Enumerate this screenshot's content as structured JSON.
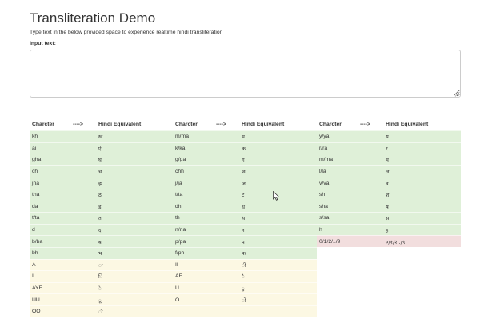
{
  "title": "Transliteration Demo",
  "description": "Type text in the below provided space to experience realtime hindi transliteration",
  "input_label": "Input text:",
  "input_value": "",
  "header": {
    "char": "Charcter",
    "arrow": "---->",
    "hindi": "Hindi Equivalent"
  },
  "columns": [
    {
      "rows": [
        {
          "c": "kh",
          "h": "ख",
          "tone": "green"
        },
        {
          "c": "ai",
          "h": "ऐ",
          "tone": "green"
        },
        {
          "c": "gha",
          "h": "घ",
          "tone": "green"
        },
        {
          "c": "ch",
          "h": "च",
          "tone": "green"
        },
        {
          "c": "jha",
          "h": "झ",
          "tone": "green"
        },
        {
          "c": "tha",
          "h": "ठ",
          "tone": "green"
        },
        {
          "c": "da",
          "h": "ड",
          "tone": "green"
        },
        {
          "c": "t/ta",
          "h": "त",
          "tone": "green"
        },
        {
          "c": "d",
          "h": "द",
          "tone": "green"
        },
        {
          "c": "b/ba",
          "h": "ब",
          "tone": "green"
        },
        {
          "c": "bh",
          "h": "भ",
          "tone": "green"
        },
        {
          "c": "A",
          "h": "ा",
          "tone": "yellow"
        },
        {
          "c": "I",
          "h": "ि",
          "tone": "yellow"
        },
        {
          "c": "AYE",
          "h": "े",
          "tone": "yellow"
        },
        {
          "c": "UU",
          "h": "ू",
          "tone": "yellow"
        },
        {
          "c": "OO",
          "h": "ौ",
          "tone": "yellow"
        }
      ]
    },
    {
      "rows": [
        {
          "c": "m/ma",
          "h": "म",
          "tone": "green"
        },
        {
          "c": "k/ka",
          "h": "क",
          "tone": "green"
        },
        {
          "c": "g/ga",
          "h": "ग",
          "tone": "green"
        },
        {
          "c": "chh",
          "h": "छ",
          "tone": "green"
        },
        {
          "c": "j/ja",
          "h": "ज",
          "tone": "green"
        },
        {
          "c": "t/ta",
          "h": "ट",
          "tone": "green"
        },
        {
          "c": "dh",
          "h": "ध",
          "tone": "green"
        },
        {
          "c": "th",
          "h": "थ",
          "tone": "green"
        },
        {
          "c": "n/na",
          "h": "न",
          "tone": "green"
        },
        {
          "c": "p/pa",
          "h": "प",
          "tone": "green"
        },
        {
          "c": "f/ph",
          "h": "फ",
          "tone": "green"
        },
        {
          "c": "II",
          "h": "ी",
          "tone": "yellow"
        },
        {
          "c": "AE",
          "h": "ै",
          "tone": "yellow"
        },
        {
          "c": "U",
          "h": "ु",
          "tone": "yellow"
        },
        {
          "c": "O",
          "h": "ो",
          "tone": "yellow"
        },
        {
          "c": "",
          "h": "",
          "tone": "yellow"
        }
      ]
    },
    {
      "rows": [
        {
          "c": "y/ya",
          "h": "य",
          "tone": "green"
        },
        {
          "c": "r/ra",
          "h": "र",
          "tone": "green"
        },
        {
          "c": "m/ma",
          "h": "म",
          "tone": "green"
        },
        {
          "c": "l/la",
          "h": "ल",
          "tone": "green"
        },
        {
          "c": "v/va",
          "h": "व",
          "tone": "green"
        },
        {
          "c": "sh",
          "h": "श",
          "tone": "green"
        },
        {
          "c": "sha",
          "h": "ष",
          "tone": "green"
        },
        {
          "c": "s/sa",
          "h": "स",
          "tone": "green"
        },
        {
          "c": "h",
          "h": "ह",
          "tone": "green"
        },
        {
          "c": "0/1/2/../9",
          "h": "०/१/२../९",
          "tone": "red"
        }
      ]
    }
  ],
  "colors": {
    "green": "#dff0d8",
    "yellow": "#fcf8e3",
    "red": "#f2dede"
  }
}
